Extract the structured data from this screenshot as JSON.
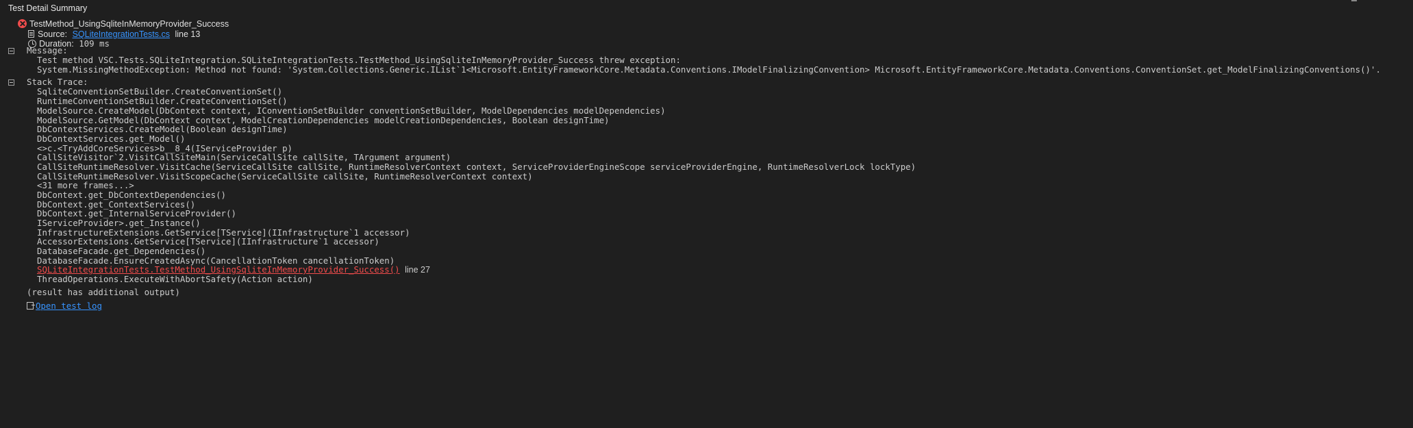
{
  "panel": {
    "title": "Test Detail Summary"
  },
  "test": {
    "name": "TestMethod_UsingSqliteInMemoryProvider_Success",
    "status_icon": "error-icon",
    "source_label": "Source:",
    "source_file": "SQLiteIntegrationTests.cs",
    "source_line": "line 13",
    "duration_label": "Duration:",
    "duration_value": "109 ms"
  },
  "message": {
    "label": "Message:",
    "lines": [
      "Test method VSC.Tests.SQLiteIntegration.SQLiteIntegrationTests.TestMethod_UsingSqliteInMemoryProvider_Success threw exception:",
      "System.MissingMethodException: Method not found: 'System.Collections.Generic.IList`1<Microsoft.EntityFrameworkCore.Metadata.Conventions.IModelFinalizingConvention> Microsoft.EntityFrameworkCore.Metadata.Conventions.ConventionSet.get_ModelFinalizingConventions()'."
    ]
  },
  "stack_trace": {
    "label": "Stack Trace:",
    "frames_top": [
      "SqliteConventionSetBuilder.CreateConventionSet()",
      "RuntimeConventionSetBuilder.CreateConventionSet()",
      "ModelSource.CreateModel(DbContext context, IConventionSetBuilder conventionSetBuilder, ModelDependencies modelDependencies)",
      "ModelSource.GetModel(DbContext context, ModelCreationDependencies modelCreationDependencies, Boolean designTime)",
      "DbContextServices.CreateModel(Boolean designTime)",
      "DbContextServices.get_Model()",
      "<>c.<TryAddCoreServices>b__8_4(IServiceProvider p)",
      "CallSiteVisitor`2.VisitCallSiteMain(ServiceCallSite callSite, TArgument argument)",
      "CallSiteRuntimeResolver.VisitCache(ServiceCallSite callSite, RuntimeResolverContext context, ServiceProviderEngineScope serviceProviderEngine, RuntimeResolverLock lockType)",
      "CallSiteRuntimeResolver.VisitScopeCache(ServiceCallSite callSite, RuntimeResolverContext context)",
      "<31 more frames...>",
      "DbContext.get_DbContextDependencies()",
      "DbContext.get_ContextServices()",
      "DbContext.get_InternalServiceProvider()",
      "IServiceProvider>.get_Instance()",
      "InfrastructureExtensions.GetService[TService](IInfrastructure`1 accessor)",
      "AccessorExtensions.GetService[TService](IInfrastructure`1 accessor)",
      "DatabaseFacade.get_Dependencies()",
      "DatabaseFacade.EnsureCreatedAsync(CancellationToken cancellationToken)"
    ],
    "user_frame": "SQLiteIntegrationTests.TestMethod_UsingSqliteInMemoryProvider_Success()",
    "user_frame_line": "line 27",
    "frame_last": "ThreadOperations.ExecuteWithAbortSafety(Action action)"
  },
  "additional_output": "(result has additional output)",
  "open_log_label": "Open test log",
  "colors": {
    "background": "#1f1f1f",
    "text": "#cccccc",
    "link": "#3794ff",
    "error": "#f14c4c"
  }
}
